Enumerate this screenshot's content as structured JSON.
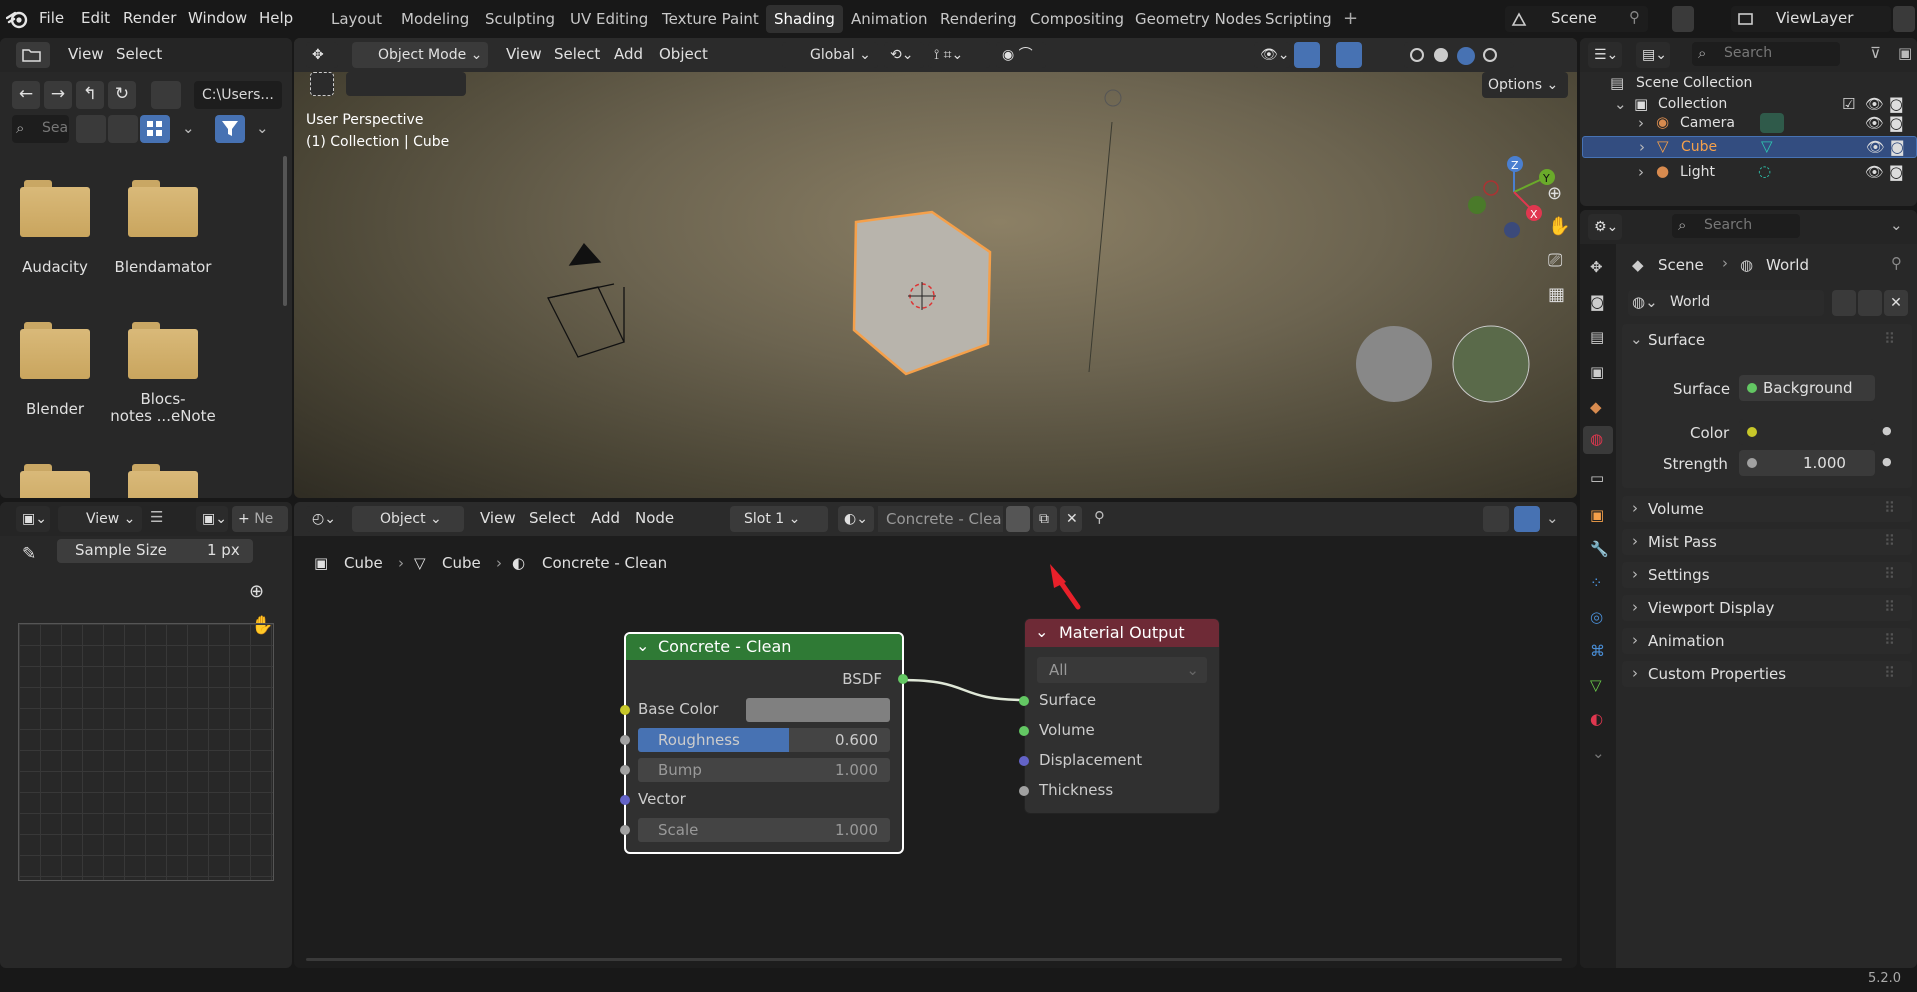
{
  "app": {
    "version": "5.2.0"
  },
  "menu": {
    "file": "File",
    "edit": "Edit",
    "render": "Render",
    "window": "Window",
    "help": "Help"
  },
  "workspaces": [
    "Layout",
    "Modeling",
    "Sculpting",
    "UV Editing",
    "Texture Paint",
    "Shading",
    "Animation",
    "Rendering",
    "Compositing",
    "Geometry Nodes",
    "Scripting"
  ],
  "active_workspace": "Shading",
  "scene": {
    "name": "Scene",
    "view_layer": "ViewLayer"
  },
  "file_browser": {
    "menu": [
      "View",
      "Select"
    ],
    "path": "C:\\Users...",
    "search_placeholder": "Sea",
    "folders": [
      {
        "name": "Audacity"
      },
      {
        "name": "Blendamator"
      },
      {
        "name": "Blender"
      },
      {
        "name": "Blocs-\nnotes ...eNote"
      }
    ]
  },
  "viewport": {
    "mode": "Object Mode",
    "menu": [
      "View",
      "Select",
      "Add",
      "Object"
    ],
    "transform": "Global",
    "options": "Options",
    "info_line1": "User Perspective",
    "info_line2": "(1) Collection | Cube",
    "gizmo": {
      "z": "Z",
      "y": "Y",
      "x": "X"
    }
  },
  "image_editor": {
    "view": "View",
    "new_label": "Ne",
    "sample_size_label": "Sample Size",
    "sample_size_value": "1 px"
  },
  "node_editor": {
    "type": "Object",
    "menu": [
      "View",
      "Select",
      "Add",
      "Node"
    ],
    "slot": "Slot 1",
    "material_name": "Concrete - Clean",
    "breadcrumb": [
      "Cube",
      "Cube",
      "Concrete - Clean"
    ],
    "group_node": {
      "title": "Concrete - Clean",
      "output": "BSDF",
      "inputs": [
        {
          "label": "Base Color"
        },
        {
          "label": "Roughness",
          "value": "0.600",
          "fill": 0.6
        },
        {
          "label": "Bump",
          "value": "1.000"
        },
        {
          "label": "Vector"
        },
        {
          "label": "Scale",
          "value": "1.000"
        }
      ]
    },
    "output_node": {
      "title": "Material Output",
      "target": "All",
      "inputs": [
        "Surface",
        "Volume",
        "Displacement",
        "Thickness"
      ]
    }
  },
  "outliner": {
    "search_placeholder": "Search",
    "root": "Scene Collection",
    "collection": "Collection",
    "items": [
      "Camera",
      "Cube",
      "Light"
    ]
  },
  "properties": {
    "search_placeholder": "Search",
    "breadcrumb_scene": "Scene",
    "breadcrumb_world": "World",
    "world_name": "World",
    "surface_section": "Surface",
    "surface_label": "Surface",
    "surface_value": "Background",
    "color_label": "Color",
    "strength_label": "Strength",
    "strength_value": "1.000",
    "sections": [
      "Volume",
      "Mist Pass",
      "Settings",
      "Viewport Display",
      "Animation",
      "Custom Properties"
    ]
  },
  "colors": {
    "accent_blue": "#4772b3",
    "selection_orange": "#f5a04a",
    "node_group_header": "#2f7a35",
    "node_output_header": "#6e2a36",
    "arrow_red": "#e8202a"
  }
}
